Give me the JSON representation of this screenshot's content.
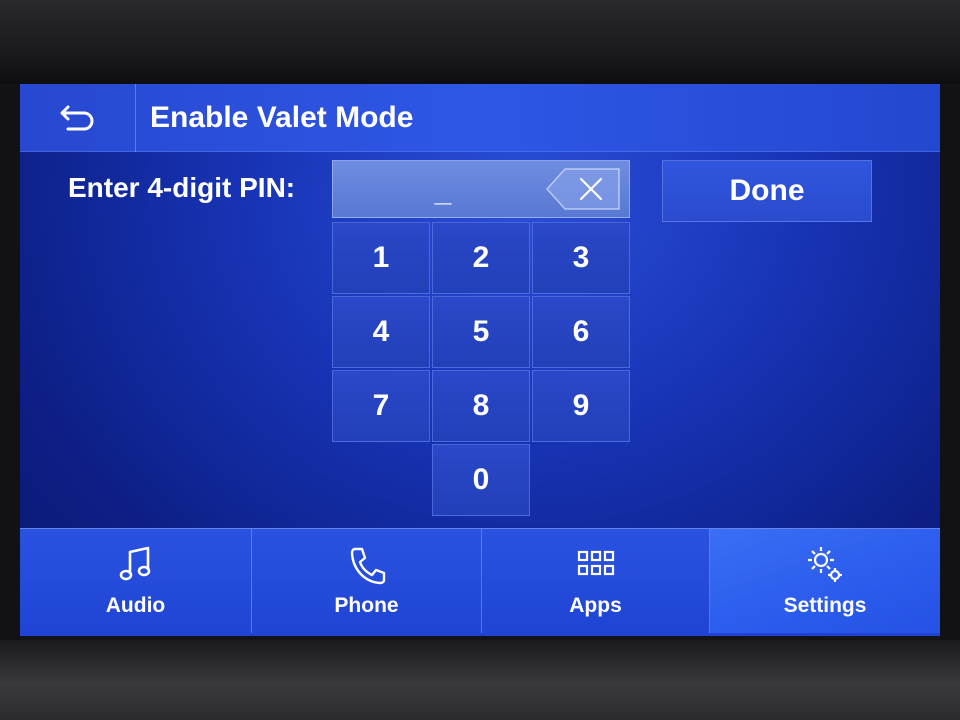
{
  "header": {
    "back_icon": "back-arrow-icon",
    "title": "Enable Valet Mode"
  },
  "pin_entry": {
    "label": "Enter 4-digit PIN:",
    "value": "_",
    "backspace_icon": "backspace-icon",
    "done_label": "Done"
  },
  "keypad": {
    "keys": [
      "1",
      "2",
      "3",
      "4",
      "5",
      "6",
      "7",
      "8",
      "9",
      "0"
    ]
  },
  "navbar": {
    "items": [
      {
        "label": "Audio",
        "icon": "music-note-icon",
        "active": false
      },
      {
        "label": "Phone",
        "icon": "phone-icon",
        "active": false
      },
      {
        "label": "Apps",
        "icon": "apps-grid-icon",
        "active": false
      },
      {
        "label": "Settings",
        "icon": "gear-icon",
        "active": true
      }
    ]
  },
  "colors": {
    "screen_blue": "#1733b4",
    "header_blue": "#2e57e6",
    "active_tab": "#3a6ff5",
    "pin_field": "#6f8de0",
    "text": "#ffffff"
  }
}
